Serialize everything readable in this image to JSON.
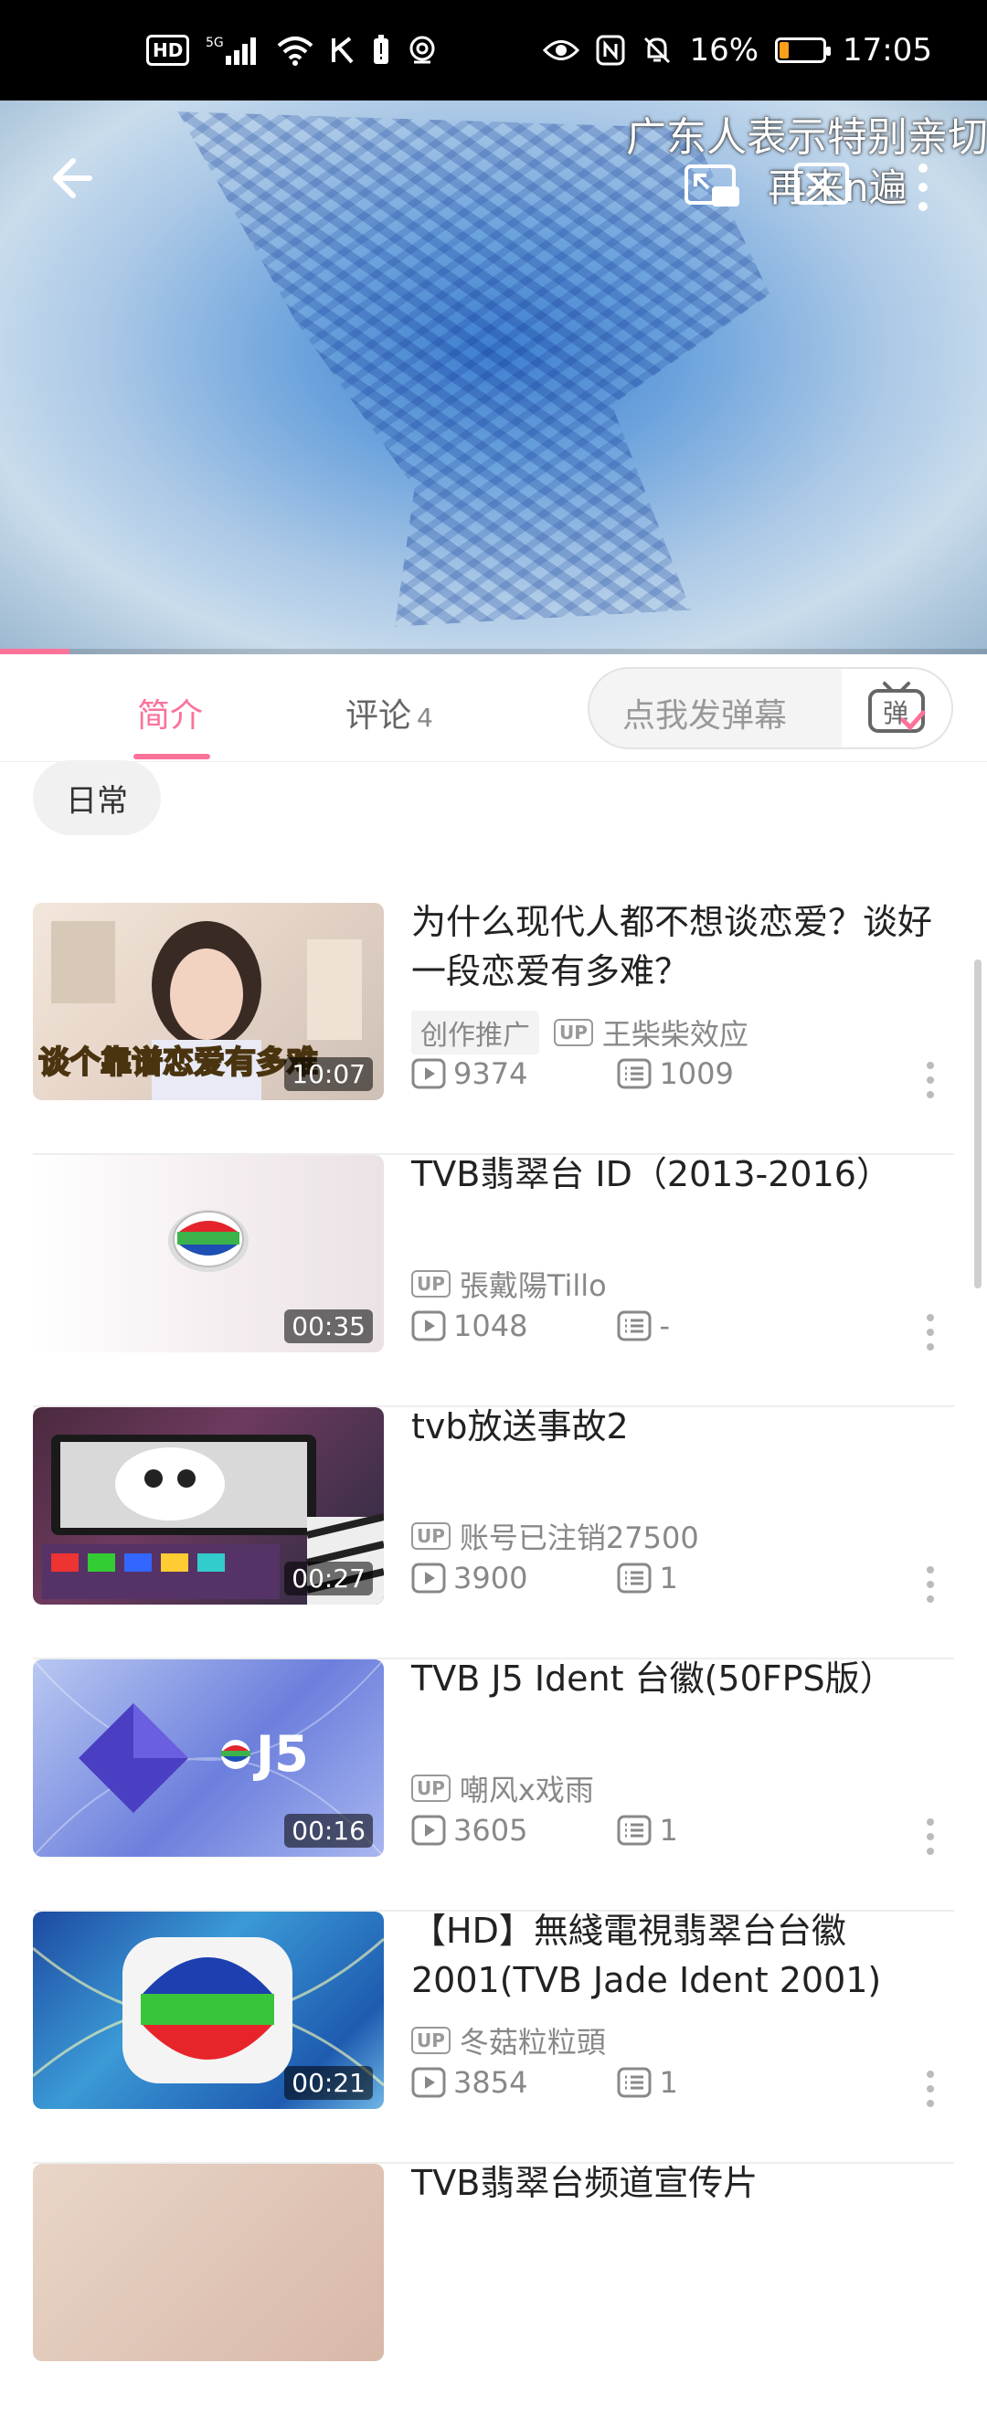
{
  "status_bar": {
    "network_badge": "HD",
    "network_type": "5G",
    "battery_percent": "16%",
    "time": "17:05"
  },
  "video": {
    "danmaku_line1": "广东人表示特别亲切",
    "danmaku_line2": "再来n遍",
    "progress_fraction": 0.07
  },
  "tabs": {
    "intro_label": "简介",
    "comments_label": "评论",
    "comments_count": "4",
    "danmaku_placeholder": "点我发弹幕",
    "danmaku_button": "弹"
  },
  "tag": "日常",
  "videos": [
    {
      "title": "为什么现代人都不想谈恋爱？谈好一段恋爱有多难？",
      "promo": "创作推广",
      "uploader": "王柴柴效应",
      "views": "9374",
      "danmaku_count": "1009",
      "duration": "10:07",
      "thumb_caption": "谈个靠谱恋爱有多难"
    },
    {
      "title": "TVB翡翠台 ID（2013-2016）",
      "uploader": "張戴陽Tillo",
      "views": "1048",
      "danmaku_count": "-",
      "duration": "00:35"
    },
    {
      "title": "tvb放送事故2",
      "uploader": "账号已注销27500",
      "views": "3900",
      "danmaku_count": "1",
      "duration": "00:27"
    },
    {
      "title": "TVB J5 Ident 台徽(50FPS版）",
      "uploader": "嘲风x戏雨",
      "views": "3605",
      "danmaku_count": "1",
      "duration": "00:16",
      "thumb_caption": "J5"
    },
    {
      "title": "【HD】無綫電視翡翠台台徽2001(TVB Jade Ident 2001)",
      "uploader": "冬菇粒粒頭",
      "views": "3854",
      "danmaku_count": "1",
      "duration": "00:21"
    },
    {
      "title": "TVB翡翠台频道宣传片"
    }
  ],
  "icons": {
    "back": "arrow-left-icon",
    "pip": "picture-in-picture-icon",
    "cast": "cast-icon",
    "more": "more-vertical-icon",
    "play": "play-count-icon",
    "danmaku": "danmaku-count-icon"
  },
  "colors": {
    "accent": "#fb7299",
    "status_bar": "#000000"
  }
}
